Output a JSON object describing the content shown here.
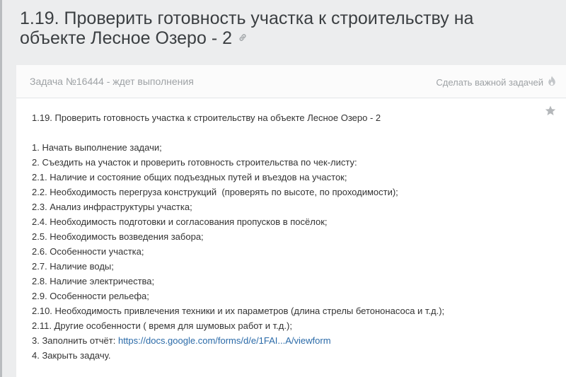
{
  "page": {
    "title": "1.19. Проверить готовность участка к строительству на объекте Лесное Озеро - 2"
  },
  "panel": {
    "task_status": "Задача №16444 - ждет выполнения",
    "make_important_label": "Сделать важной задачей",
    "description_title": "1.19. Проверить готовность участка к строительству на объекте Лесное Озеро - 2",
    "lines": [
      "1. Начать выполнение задачи;",
      "2. Съездить на участок и проверить готовность строительства по чек-листу:",
      "2.1. Наличие и состояние общих подъездных путей и въездов на участок;",
      "2.2. Необходимость перегруза конструкций  (проверять по высоте, по проходимости);",
      "2.3. Анализ инфраструктуры участка;",
      "2.4. Необходимость подготовки и согласования пропусков в посёлок;",
      "2.5. Необходимость возведения забора;",
      "2.6. Особенности участка;",
      "2.7. Наличие воды;",
      "2.8. Наличие электричества;",
      "2.9. Особенности рельефа;",
      "2.10. Необходимость привлечения техники и их параметров (длина стрелы бетононасоса и т.д.);",
      "2.11. Другие особенности ( время для шумовых работ и т.д.);"
    ],
    "report_prefix": "3. Заполнить отчёт: ",
    "report_link": "https://docs.google.com/forms/d/e/1FAI...A/viewform",
    "close_line": "4. Закрыть задачу."
  },
  "colors": {
    "background": "#ecedee",
    "panel": "#ffffff",
    "muted_text": "#9ea2a5",
    "link": "#2a6aa8"
  },
  "icons": {
    "title_link": "link-icon",
    "important": "flame-icon",
    "favorite": "star-icon"
  }
}
